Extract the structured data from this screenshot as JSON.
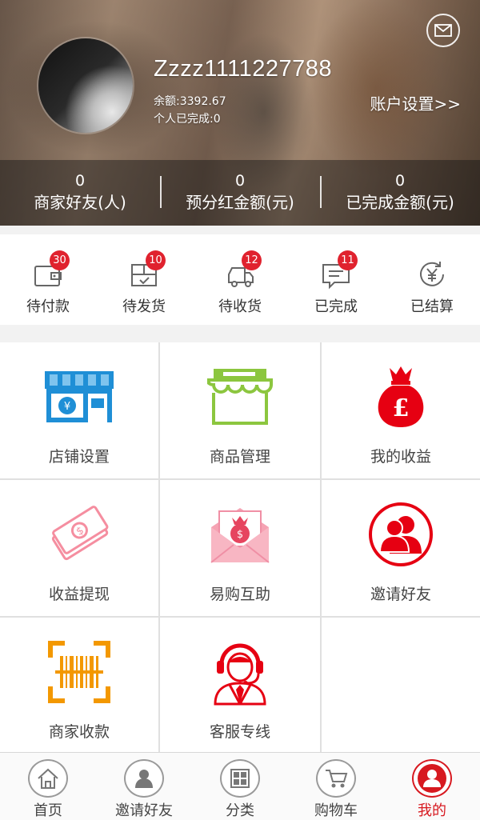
{
  "header": {
    "username": "Zzzz1111227788",
    "balance": "余额:3392.67",
    "completed": "个人已完成:0",
    "account_settings": "账户设置>>",
    "mail_icon": "mail-icon",
    "stats": [
      {
        "value": "0",
        "label": "商家好友(人)"
      },
      {
        "value": "0",
        "label": "预分红金额(元)"
      },
      {
        "value": "0",
        "label": "已完成金额(元)"
      }
    ]
  },
  "orders": [
    {
      "label": "待付款",
      "badge": "30",
      "icon": "wallet-icon"
    },
    {
      "label": "待发货",
      "badge": "10",
      "icon": "package-icon"
    },
    {
      "label": "待收货",
      "badge": "12",
      "icon": "truck-icon"
    },
    {
      "label": "已完成",
      "badge": "11",
      "icon": "message-icon"
    },
    {
      "label": "已结算",
      "badge": "",
      "icon": "yen-refresh-icon"
    }
  ],
  "grid": [
    {
      "label": "店铺设置",
      "icon": "store-icon"
    },
    {
      "label": "商品管理",
      "icon": "shop-awning-icon"
    },
    {
      "label": "我的收益",
      "icon": "money-bag-icon"
    },
    {
      "label": "收益提现",
      "icon": "cash-icon"
    },
    {
      "label": "易购互助",
      "icon": "envelope-money-icon"
    },
    {
      "label": "邀请好友",
      "icon": "friends-icon"
    },
    {
      "label": "商家收款",
      "icon": "barcode-icon"
    },
    {
      "label": "客服专线",
      "icon": "customer-service-icon"
    }
  ],
  "bottom_nav": [
    {
      "label": "首页",
      "icon": "home-icon",
      "active": false
    },
    {
      "label": "邀请好友",
      "icon": "invite-icon",
      "active": false
    },
    {
      "label": "分类",
      "icon": "category-icon",
      "active": false
    },
    {
      "label": "购物车",
      "icon": "cart-icon",
      "active": false
    },
    {
      "label": "我的",
      "icon": "me-icon",
      "active": true
    }
  ],
  "colors": {
    "accent": "#d71920",
    "badge": "#e0222e",
    "store_blue": "#1f8fd6",
    "awning_green": "#8cc63f",
    "barcode_orange": "#f39800",
    "pink": "#f58ea0"
  }
}
